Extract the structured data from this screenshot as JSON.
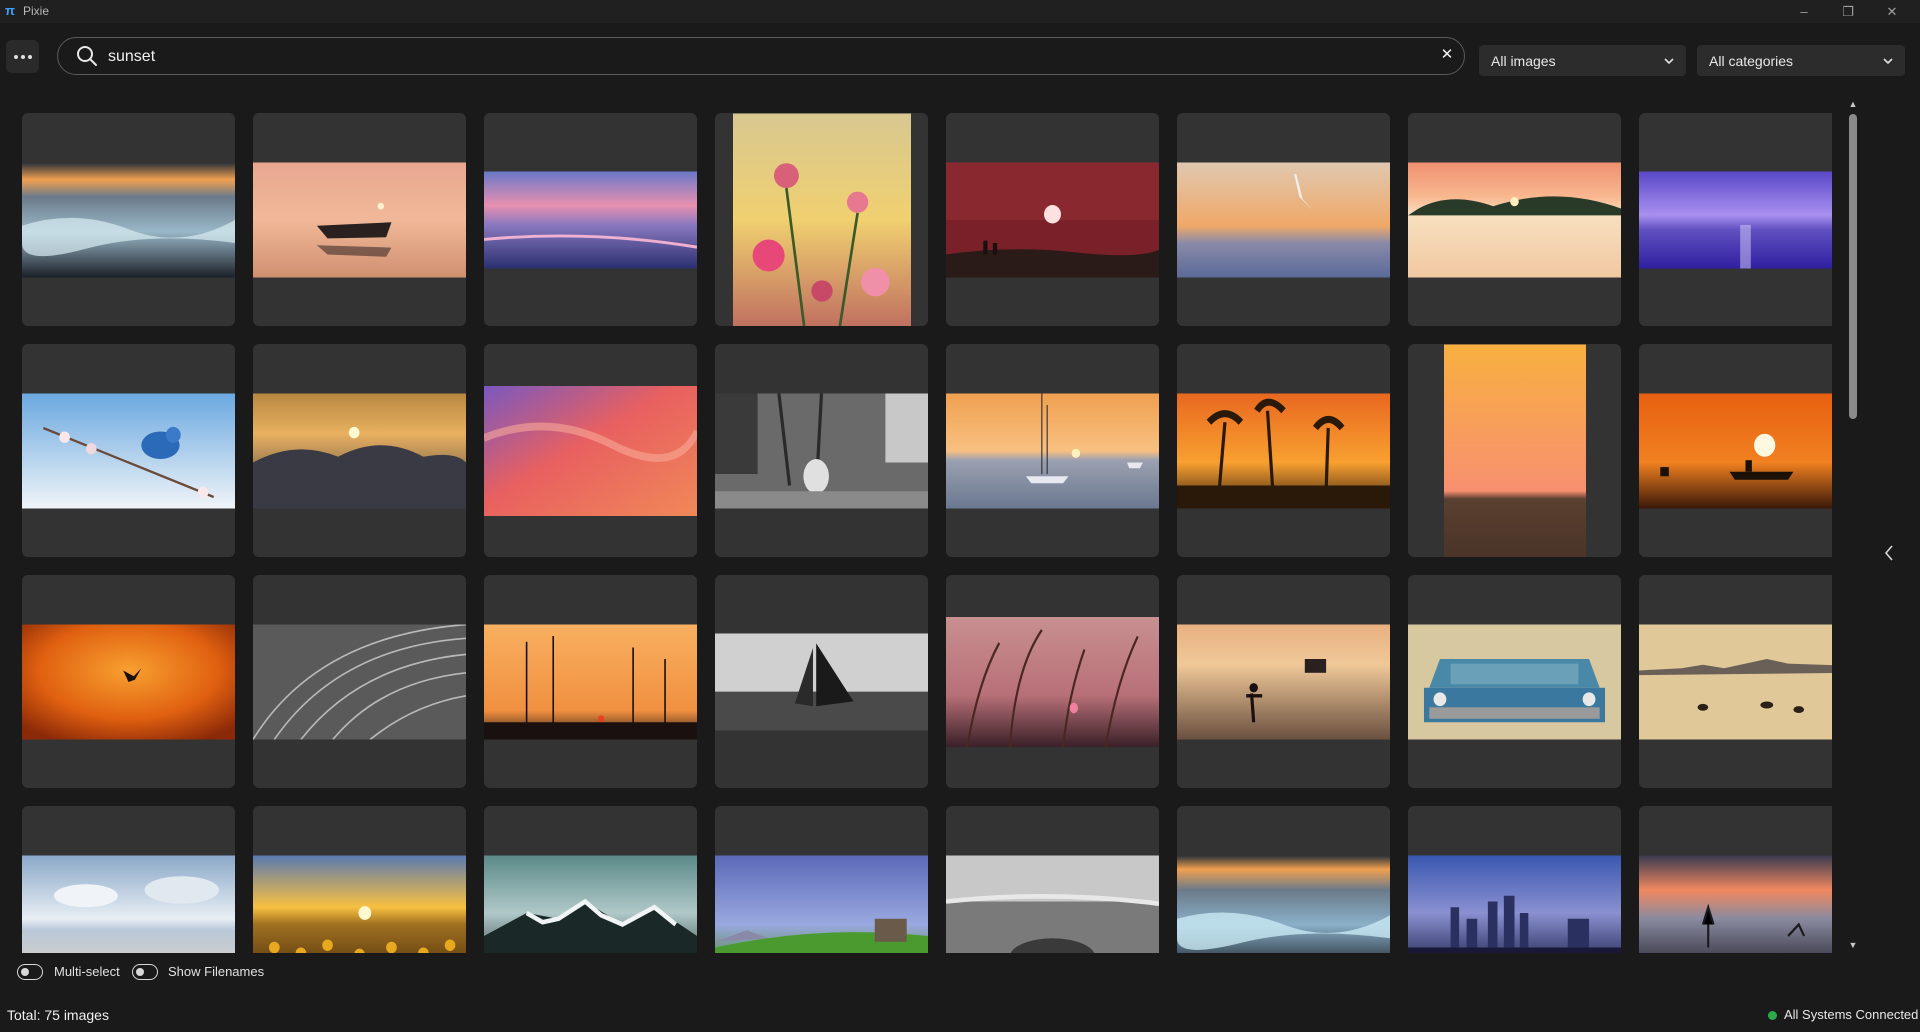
{
  "app": {
    "title": "Pixie",
    "logo_glyph": "π"
  },
  "window_controls": {
    "minimize": "–",
    "maximize": "❐",
    "close": "✕"
  },
  "toolbar": {
    "menu_icon": "more-horizontal-icon",
    "search": {
      "value": "sunset",
      "placeholder": ""
    },
    "filter_images": {
      "selected": "All images"
    },
    "filter_categories": {
      "selected": "All categories"
    }
  },
  "grid": {
    "columns": 8,
    "images": [
      {
        "id": 1,
        "kind": "landscape",
        "desc": "icy-beach-sunset"
      },
      {
        "id": 2,
        "kind": "landscape",
        "desc": "boat-on-calm-water"
      },
      {
        "id": 3,
        "kind": "wide",
        "desc": "pink-purple-shoreline"
      },
      {
        "id": 4,
        "kind": "portrait",
        "desc": "cosmos-flowers"
      },
      {
        "id": 5,
        "kind": "landscape",
        "desc": "red-sun-silhouettes"
      },
      {
        "id": 6,
        "kind": "landscape",
        "desc": "seagull-over-sea"
      },
      {
        "id": 7,
        "kind": "landscape",
        "desc": "beach-footprints"
      },
      {
        "id": 8,
        "kind": "wide",
        "desc": "purple-sky-sea"
      },
      {
        "id": 9,
        "kind": "landscape",
        "desc": "bluebird-blossom"
      },
      {
        "id": 10,
        "kind": "landscape",
        "desc": "sun-behind-clouds"
      },
      {
        "id": 11,
        "kind": "landscape-tall",
        "desc": "pink-orange-clouds"
      },
      {
        "id": 12,
        "kind": "landscape",
        "desc": "bw-street-man"
      },
      {
        "id": 13,
        "kind": "landscape",
        "desc": "sailboats-sunset"
      },
      {
        "id": 14,
        "kind": "landscape",
        "desc": "palm-trees-orange"
      },
      {
        "id": 15,
        "kind": "portrait",
        "desc": "desert-horizon"
      },
      {
        "id": 16,
        "kind": "landscape",
        "desc": "ship-orange-sunset"
      },
      {
        "id": 17,
        "kind": "landscape",
        "desc": "orange-sky-bird"
      },
      {
        "id": 18,
        "kind": "landscape",
        "desc": "bw-running-track"
      },
      {
        "id": 19,
        "kind": "landscape",
        "desc": "harbor-masts"
      },
      {
        "id": 20,
        "kind": "wide",
        "desc": "bw-sailboat"
      },
      {
        "id": 21,
        "kind": "landscape-tall",
        "desc": "grass-sunset"
      },
      {
        "id": 22,
        "kind": "landscape",
        "desc": "photographer-on-beach"
      },
      {
        "id": 23,
        "kind": "landscape",
        "desc": "blue-pickup-truck"
      },
      {
        "id": 24,
        "kind": "landscape",
        "desc": "ducks-at-dusk"
      },
      {
        "id": 25,
        "kind": "landscape",
        "desc": "cloudy-beach"
      },
      {
        "id": 26,
        "kind": "landscape",
        "desc": "sunflower-field"
      },
      {
        "id": 27,
        "kind": "landscape",
        "desc": "snowy-mountains"
      },
      {
        "id": 28,
        "kind": "landscape",
        "desc": "hill-hut"
      },
      {
        "id": 29,
        "kind": "landscape",
        "desc": "bw-rock-beach"
      },
      {
        "id": 30,
        "kind": "landscape",
        "desc": "icy-beach-sunset-2"
      },
      {
        "id": 31,
        "kind": "landscape",
        "desc": "city-skyline-dusk"
      },
      {
        "id": 32,
        "kind": "landscape",
        "desc": "heron-at-dusk"
      }
    ]
  },
  "options": {
    "multi_select": {
      "label": "Multi-select",
      "on": false
    },
    "show_filenames": {
      "label": "Show Filenames",
      "on": false
    }
  },
  "footer": {
    "total": "Total: 75 images",
    "status": "All Systems Connected",
    "status_color": "#2aa84a"
  }
}
